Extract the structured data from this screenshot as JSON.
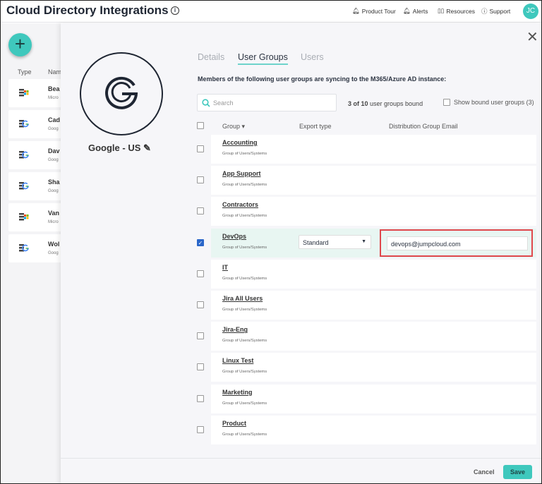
{
  "header": {
    "title": "Cloud Directory Integrations",
    "info_icon": "i",
    "nav": [
      {
        "label": "Product Tour",
        "icon": "rocket-icon"
      },
      {
        "label": "Alerts",
        "icon": "bell-icon"
      },
      {
        "label": "Resources",
        "icon": "book-icon"
      },
      {
        "label": "Support",
        "icon": "help-icon"
      }
    ],
    "avatar": "JC"
  },
  "list": {
    "add": "+",
    "col_type": "Type",
    "col_name": "Nam",
    "items": [
      {
        "name": "Bea",
        "sub": "Micro",
        "type": "microsoft"
      },
      {
        "name": "Cad",
        "sub": "Goog",
        "type": "google"
      },
      {
        "name": "Dav",
        "sub": "Goog",
        "type": "google"
      },
      {
        "name": "Sha",
        "sub": "Goog",
        "type": "google"
      },
      {
        "name": "Van",
        "sub": "Micro",
        "type": "microsoft"
      },
      {
        "name": "Wol",
        "sub": "Goog",
        "type": "google"
      }
    ]
  },
  "panel": {
    "close": "✕",
    "directory_name": "Google - US",
    "tabs": [
      {
        "label": "Details"
      },
      {
        "label": "User Groups",
        "active": true
      },
      {
        "label": "Users"
      }
    ],
    "description": "Members of the following user groups are syncing to the M365/Azure AD instance:",
    "search_placeholder": "Search",
    "bound_count": "3 of 10",
    "bound_text": " user groups bound",
    "show_bound": "Show bound user groups (3)",
    "columns": {
      "group": "Group ▾",
      "export": "Export type",
      "email": "Distribution Group Email"
    },
    "groups": [
      {
        "name": "Accounting",
        "sub": "Group of Users/Systems",
        "checked": false
      },
      {
        "name": "App Support",
        "sub": "Group of Users/Systems",
        "checked": false
      },
      {
        "name": "Contractors",
        "sub": "Group of Users/Systems",
        "checked": false
      },
      {
        "name": "DevOps",
        "sub": "Group of Users/Systems",
        "checked": true,
        "export_type": "Standard",
        "email": "devops@jumpcloud.com"
      },
      {
        "name": "IT",
        "sub": "Group of Users/Systems",
        "checked": false
      },
      {
        "name": "Jira All Users",
        "sub": "Group of Users/Systems",
        "checked": false
      },
      {
        "name": "Jira-Eng",
        "sub": "Group of Users/Systems",
        "checked": false
      },
      {
        "name": "Linux Test",
        "sub": "Group of Users/Systems",
        "checked": false
      },
      {
        "name": "Marketing",
        "sub": "Group of Users/Systems",
        "checked": false
      },
      {
        "name": "Product",
        "sub": "Group of Users/Systems",
        "checked": false
      }
    ],
    "cancel": "Cancel",
    "save": "Save"
  },
  "colors": {
    "accent": "#3fc8bd",
    "highlight": "#e0474c",
    "checkbox": "#2a66c9"
  }
}
